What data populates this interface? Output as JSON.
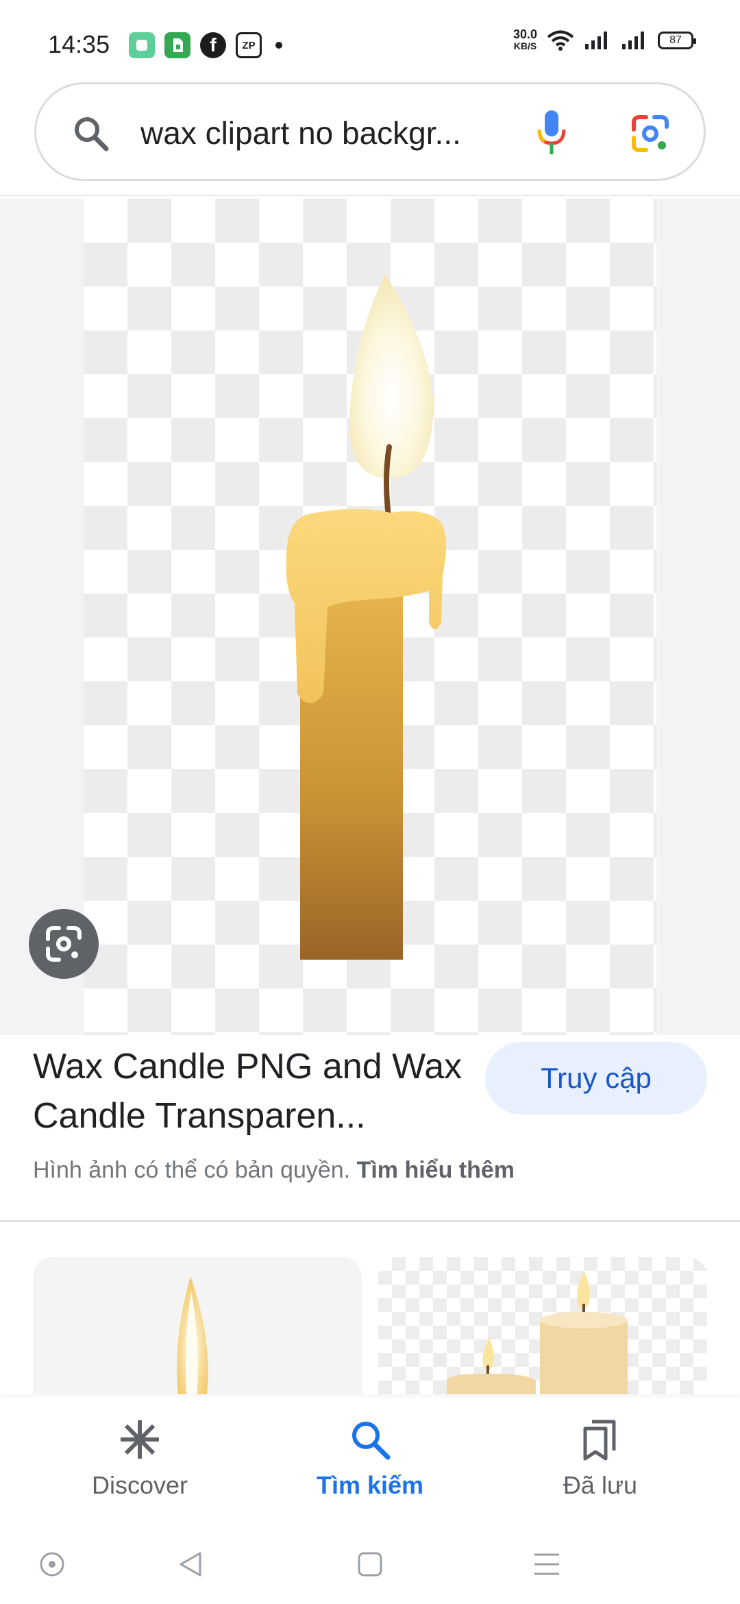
{
  "status_bar": {
    "time": "14:35",
    "net_speed_value": "30.0",
    "net_speed_unit": "KB/S",
    "battery": "87",
    "zp_label": "ZP",
    "fb_label": "f"
  },
  "search": {
    "query": "wax clipart no backgr..."
  },
  "result": {
    "title": "Wax Candle PNG and Wax Candle Transparen...",
    "visit_label": "Truy cập",
    "copyright_text": "Hình ảnh có thể có bản quyền.",
    "learn_more": "Tìm hiểu thêm"
  },
  "bottom_nav": {
    "items": [
      {
        "label": "Discover",
        "icon": "asterisk-icon"
      },
      {
        "label": "Tìm kiếm",
        "icon": "search-icon",
        "active": true
      },
      {
        "label": "Đã lưu",
        "icon": "bookmarks-icon"
      }
    ]
  },
  "colors": {
    "accent": "#1a73e8",
    "visit_button_bg": "#e8f0fe"
  }
}
